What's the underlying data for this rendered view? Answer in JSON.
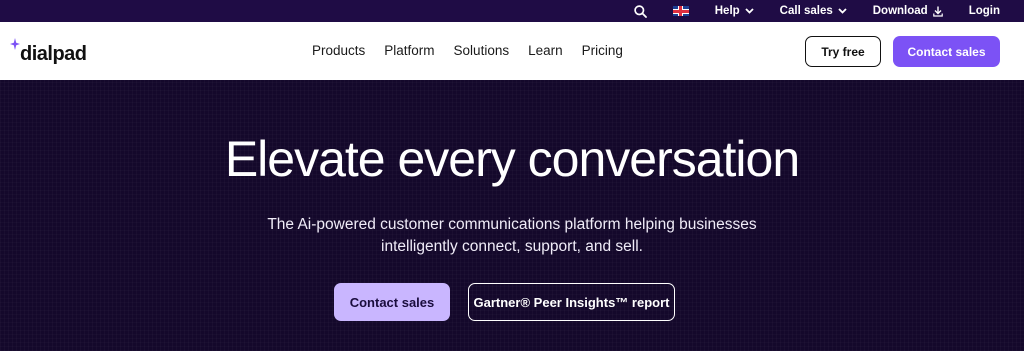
{
  "utility_bar": {
    "search_icon": "search-icon",
    "flag_icon": "uk-flag-icon",
    "help_label": "Help",
    "call_sales_label": "Call sales",
    "download_label": "Download",
    "login_label": "Login"
  },
  "nav": {
    "logo_text": "dialpad",
    "links": [
      "Products",
      "Platform",
      "Solutions",
      "Learn",
      "Pricing"
    ],
    "try_free_label": "Try free",
    "contact_sales_label": "Contact sales"
  },
  "hero": {
    "title": "Elevate every conversation",
    "subtitle_line1": "The Ai-powered customer communications platform helping businesses",
    "subtitle_line2": "intelligently connect, support, and sell.",
    "contact_sales_label": "Contact sales",
    "report_label": "Gartner® Peer Insights™ report"
  },
  "colors": {
    "hero_bg": "#14082b",
    "utility_bg": "#1f0c45",
    "accent": "#7c52f5",
    "hero_button": "#c9b6ff"
  }
}
